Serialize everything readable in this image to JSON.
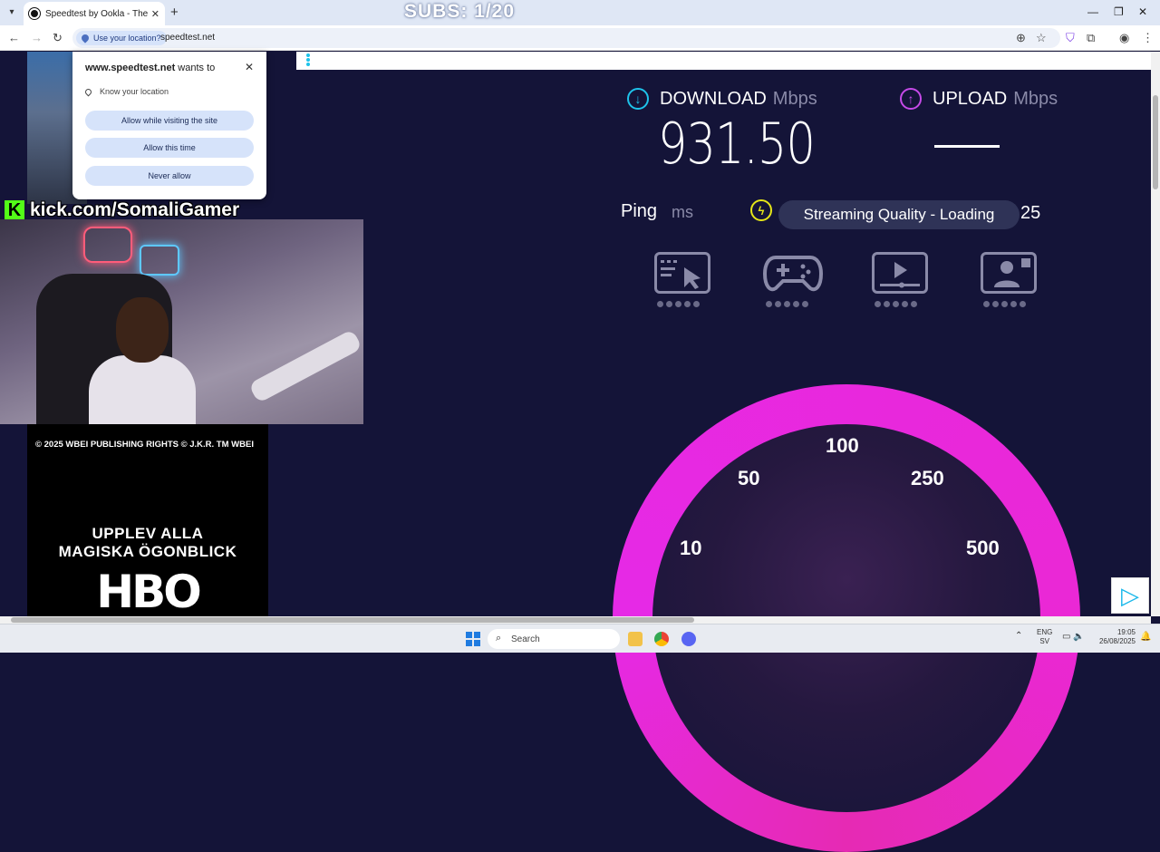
{
  "browser": {
    "tab_title": "Speedtest by Ookla - The Global",
    "tab_close": "✕",
    "new_tab": "+",
    "url": "speedtest.net",
    "location_chip": "Use your location?"
  },
  "overlay": {
    "subs": "SUBS: 1/20",
    "kick_text": "kick.com/SomaliGamer",
    "kick_logo": "K",
    "hbo_copyright": "© 2025 WBEI PUBLISHING RIGHTS © J.K.R. TM WBEI",
    "hbo_tagline_1": "UPPLEV ALLA",
    "hbo_tagline_2": "MAGISKA ÖGONBLICK",
    "hbo_logo": "HBO"
  },
  "permission_popup": {
    "site": "www.speedtest.net",
    "wants_to": " wants to",
    "request": "Know your location",
    "buttons": [
      "Allow while visiting the site",
      "Allow this time",
      "Never allow"
    ]
  },
  "speedtest": {
    "download_label": "DOWNLOAD",
    "download_unit": "Mbps",
    "download_value": "931.50",
    "upload_label": "UPLOAD",
    "upload_unit": "Mbps",
    "ping_label": "Ping",
    "ping_unit": "ms",
    "tooltip": "Streaming Quality - Loading",
    "tooltip_tail": "25",
    "gauge_labels": [
      "10",
      "50",
      "100",
      "250",
      "500"
    ],
    "accent_download": "#1ec3ea",
    "accent_upload": "#c64ae8",
    "gauge_color": "#e629e6"
  },
  "taskbar": {
    "search_placeholder": "Search",
    "lang_line1": "ENG",
    "lang_line2": "SV",
    "time": "19:05",
    "date": "26/08/2025"
  }
}
